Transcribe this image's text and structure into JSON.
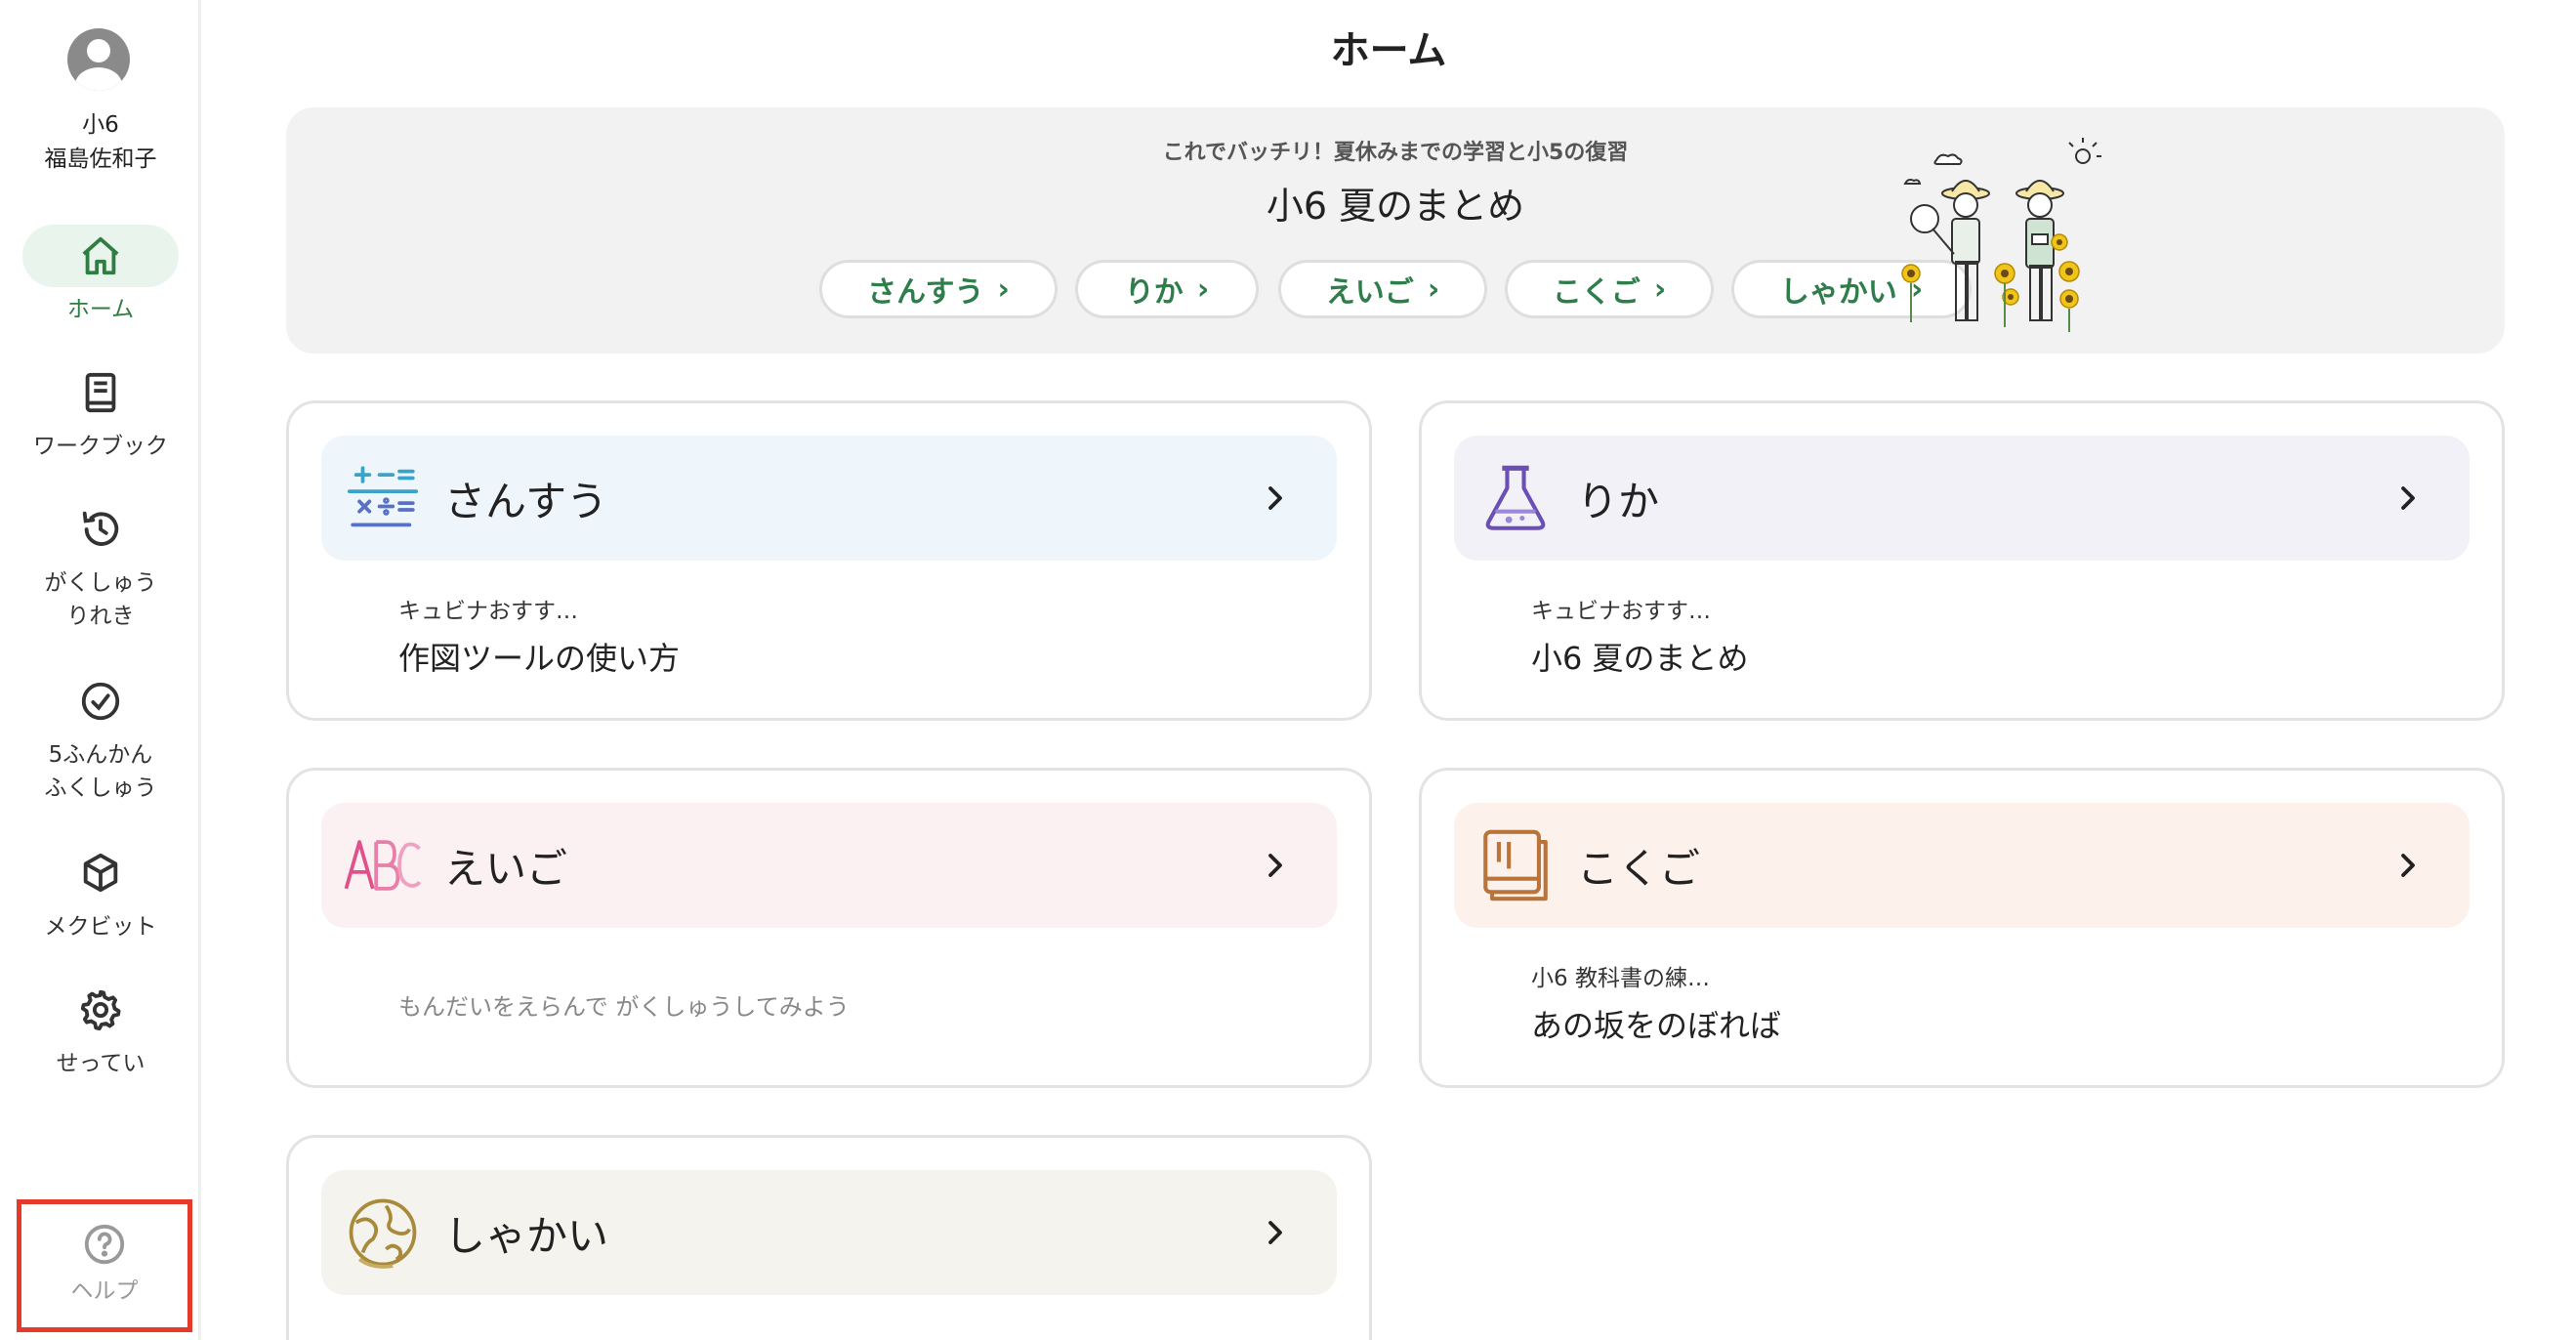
{
  "app": {
    "page_title": "ホーム"
  },
  "user": {
    "grade": "小6",
    "name": "福島佐和子"
  },
  "sidebar": {
    "items": [
      {
        "label": "ホーム",
        "icon": "home-icon",
        "active": true
      },
      {
        "label": "ワークブック",
        "icon": "workbook-icon"
      },
      {
        "label": "がくしゅう\nりれき",
        "icon": "history-icon"
      },
      {
        "label": "5ふんかん\nふくしゅう",
        "icon": "check-circle-icon"
      },
      {
        "label": "メクビット",
        "icon": "mecbit-icon"
      },
      {
        "label": "せってい",
        "icon": "gear-icon"
      }
    ],
    "help": {
      "label": "ヘルプ",
      "icon": "help-icon"
    }
  },
  "banner": {
    "subtitle": "これでバッチリ！夏休みまでの学習と小5の復習",
    "title": "小6 夏のまとめ",
    "pills": [
      "さんすう",
      "りか",
      "えいご",
      "こくご",
      "しゃかい"
    ]
  },
  "cards": [
    {
      "subject": "さんすう",
      "icon": "math-icon",
      "small": "キュビナおすす…",
      "main": "作図ツールの使い方",
      "header_color": "#eef5fb"
    },
    {
      "subject": "りか",
      "icon": "flask-icon",
      "small": "キュビナおすす…",
      "main": "小6 夏のまとめ",
      "header_color": "#f3f1f8"
    },
    {
      "subject": "えいご",
      "icon": "abc-icon",
      "hint": "もんだいをえらんで がくしゅうしてみよう",
      "header_color": "#fbf1f3"
    },
    {
      "subject": "こくご",
      "icon": "notebook-icon",
      "small": "小6 教科書の練…",
      "main": "あの坂をのぼれば",
      "header_color": "#fdf1ec"
    },
    {
      "subject": "しゃかい",
      "icon": "globe-icon",
      "header_color": "#f4f3ee"
    }
  ],
  "colors": {
    "accent": "#2e7d4a",
    "help_highlight": "#e53a2a"
  }
}
